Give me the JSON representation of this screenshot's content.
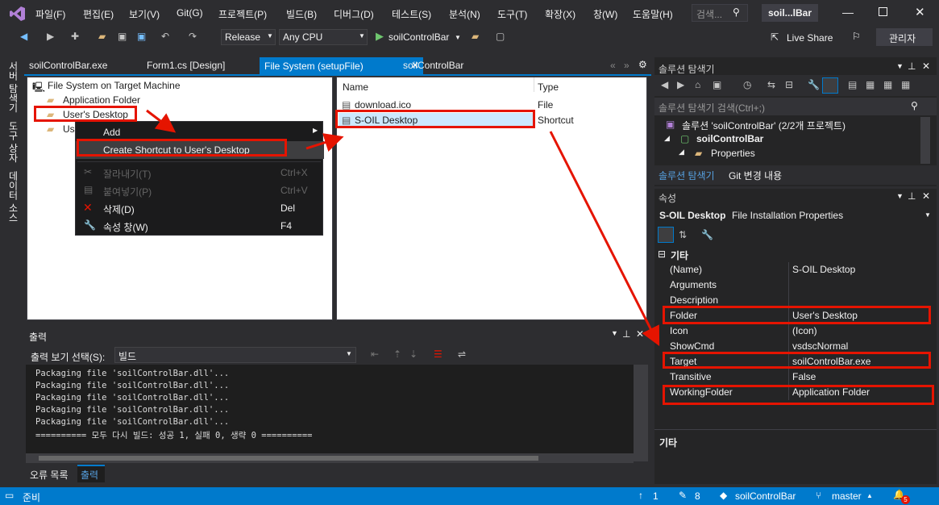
{
  "menu": {
    "items": [
      "파일(F)",
      "편집(E)",
      "보기(V)",
      "Git(G)",
      "프로젝트(P)",
      "빌드(B)",
      "디버그(D)",
      "테스트(S)",
      "분석(N)",
      "도구(T)",
      "확장(X)",
      "창(W)",
      "도움말(H)"
    ],
    "search_placeholder": "검색...",
    "solution_name": "soil...lBar",
    "live_share": "Live Share",
    "admin": "관리자"
  },
  "toolbar": {
    "config": "Release",
    "platform": "Any CPU",
    "start_target": "soilControlBar"
  },
  "side_tabs": [
    "서버 탐색기",
    "도구 상자",
    "데이터 소스"
  ],
  "doc_tabs": [
    "soilControlBar.exe",
    "Form1.cs [Design]",
    "File System (setupFile)",
    "soilControlBar"
  ],
  "fs_tree": {
    "root": "File System on Target Machine",
    "items": [
      "Application Folder",
      "User's Desktop",
      "Us"
    ]
  },
  "fs_list": {
    "col_name": "Name",
    "col_type": "Type",
    "rows": [
      {
        "name": "download.ico",
        "type": "File"
      },
      {
        "name": "S-OIL Desktop",
        "type": "Shortcut"
      }
    ]
  },
  "context_menu": {
    "add": "Add",
    "create_shortcut": "Create Shortcut to User's Desktop",
    "cut": "잘라내기(T)",
    "cut_sc": "Ctrl+X",
    "paste": "붙여넣기(P)",
    "paste_sc": "Ctrl+V",
    "delete": "삭제(D)",
    "delete_sc": "Del",
    "props": "속성 창(W)",
    "props_sc": "F4"
  },
  "output": {
    "title": "출력",
    "select_label": "출력 보기 선택(S):",
    "select_value": "빌드",
    "lines": [
      "Packaging file 'soilControlBar.dll'...",
      "Packaging file 'soilControlBar.dll'...",
      "Packaging file 'soilControlBar.dll'...",
      "Packaging file 'soilControlBar.dll'...",
      "Packaging file 'soilControlBar.dll'...",
      "========== 모두 다시 빌드: 성공 1, 실패 0, 생략 0 =========="
    ],
    "tab_errors": "오류 목록",
    "tab_output": "출력"
  },
  "solution_explorer": {
    "title": "솔루션 탐색기",
    "search": "솔루션 탐색기 검색(Ctrl+;)",
    "solution": "솔루션 'soilControlBar' (2/2개 프로젝트)",
    "project": "soilControlBar",
    "properties": "Properties",
    "tab1": "솔루션 탐색기",
    "tab2": "Git 변경 내용"
  },
  "properties": {
    "title": "속성",
    "object": "S-OIL Desktop",
    "object_type": "File Installation Properties",
    "category": "기타",
    "rows": [
      {
        "k": "(Name)",
        "v": "S-OIL Desktop"
      },
      {
        "k": "Arguments",
        "v": ""
      },
      {
        "k": "Description",
        "v": ""
      },
      {
        "k": "Folder",
        "v": "User's Desktop"
      },
      {
        "k": "Icon",
        "v": "(Icon)"
      },
      {
        "k": "ShowCmd",
        "v": "vsdscNormal"
      },
      {
        "k": "Target",
        "v": "soilControlBar.exe"
      },
      {
        "k": "Transitive",
        "v": "False"
      },
      {
        "k": "WorkingFolder",
        "v": "Application Folder"
      }
    ],
    "footer": "기타"
  },
  "status": {
    "ready": "준비",
    "up": "1",
    "edits": "8",
    "repo": "soilControlBar",
    "branch": "master",
    "notifications": "5"
  },
  "colors": {
    "accent": "#007acc",
    "highlight": "#e51400",
    "selection": "#cce8ff"
  }
}
